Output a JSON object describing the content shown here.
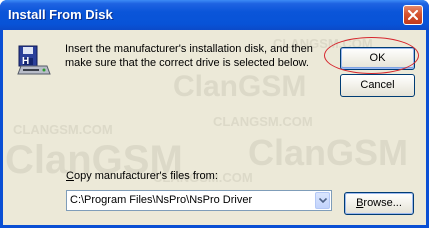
{
  "window": {
    "title": "Install From Disk"
  },
  "instruction": "Insert the manufacturer's installation disk, and then make sure that the correct drive is selected below.",
  "buttons": {
    "ok": "OK",
    "cancel": "Cancel",
    "browse_prefix": "B",
    "browse_rest": "rowse..."
  },
  "copy_from": {
    "label_prefix": "C",
    "label_rest": "opy manufacturer's files from:",
    "path": "C:\\Program Files\\NsPro\\NsPro Driver"
  },
  "watermark": {
    "brand": "ClanGSM",
    "site": "CLANGSM.COM"
  },
  "icons": {
    "disk": "disk-install-icon",
    "close": "close-icon",
    "dropdown": "chevron-down-icon"
  },
  "colors": {
    "titlebar": "#0853d7",
    "face": "#ece9d8",
    "highlight": "#d6262d"
  }
}
